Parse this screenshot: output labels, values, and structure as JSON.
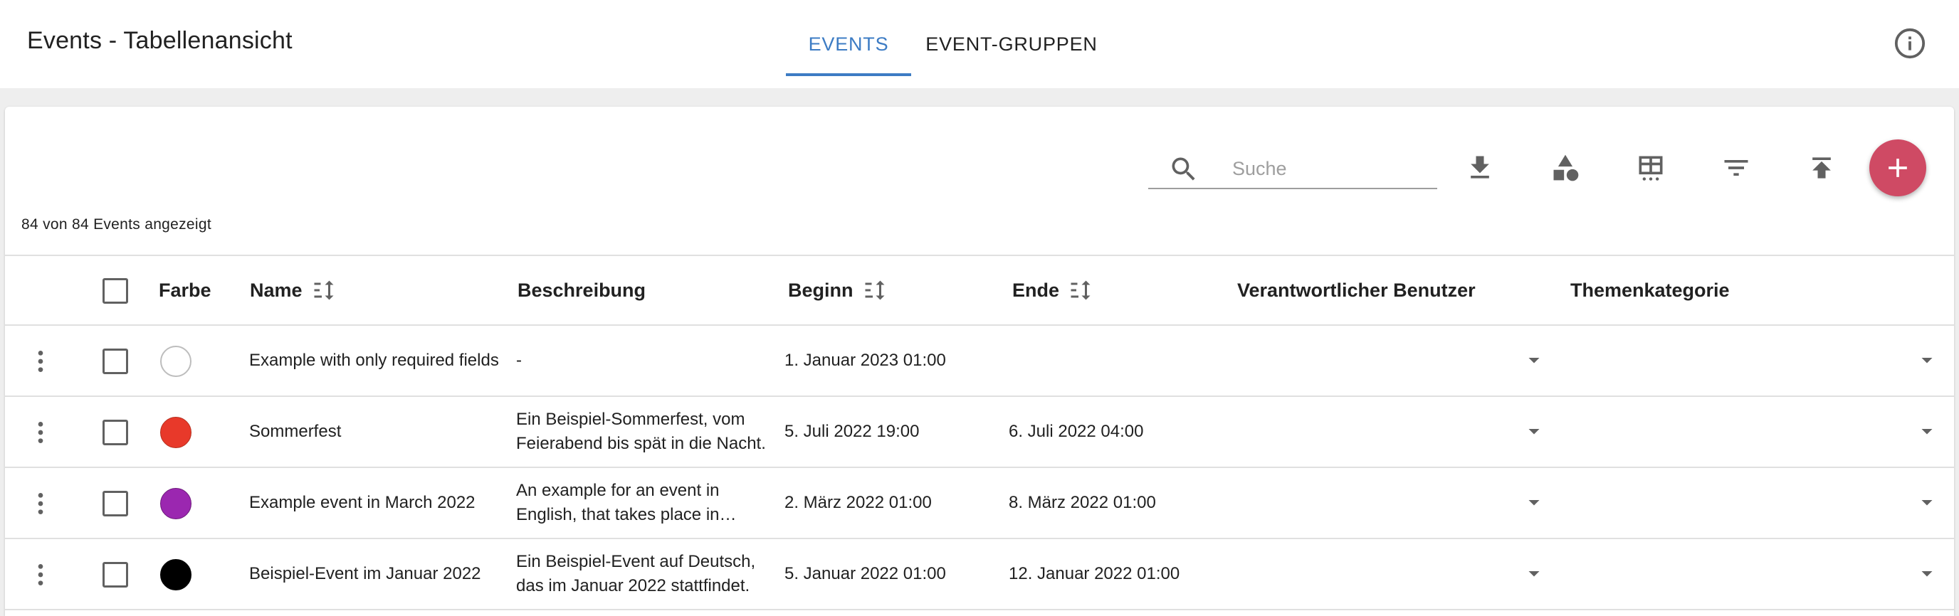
{
  "header": {
    "title": "Events - Tabellenansicht",
    "tabs": [
      {
        "label": "EVENTS",
        "active": true
      },
      {
        "label": "EVENT-GRUPPEN",
        "active": false
      }
    ]
  },
  "toolbar": {
    "search_placeholder": "Suche",
    "search_value": ""
  },
  "count_text": "84 von 84 Events angezeigt",
  "table": {
    "columns": {
      "color": "Farbe",
      "name": "Name",
      "description": "Beschreibung",
      "start": "Beginn",
      "end": "Ende",
      "responsible": "Verantwortlicher Benutzer",
      "category": "Themenkategorie"
    },
    "rows": [
      {
        "color": "#ffffff",
        "name": "Example with only required fields",
        "description": "-",
        "start": "1. Januar 2023 01:00",
        "end": "",
        "responsible": "",
        "category": ""
      },
      {
        "color": "#e8392a",
        "name": "Sommerfest",
        "description": "Ein Beispiel-Sommerfest, vom Feierabend bis spät in die Nacht.",
        "start": "5. Juli 2022 19:00",
        "end": "6. Juli 2022 04:00",
        "responsible": "",
        "category": ""
      },
      {
        "color": "#9b27b0",
        "name": "Example event in March 2022",
        "description": "An example for an event in English, that takes place in March.",
        "start": "2. März 2022 01:00",
        "end": "8. März 2022 01:00",
        "responsible": "",
        "category": ""
      },
      {
        "color": "#000000",
        "name": "Beispiel-Event im Januar 2022",
        "description": "Ein Beispiel-Event auf Deutsch, das im Januar 2022 stattfindet.",
        "start": "5. Januar 2022 01:00",
        "end": "12. Januar 2022 01:00",
        "responsible": "",
        "category": ""
      }
    ]
  },
  "colors": {
    "accent": "#3d7cc4",
    "fab": "#cf4a64"
  }
}
